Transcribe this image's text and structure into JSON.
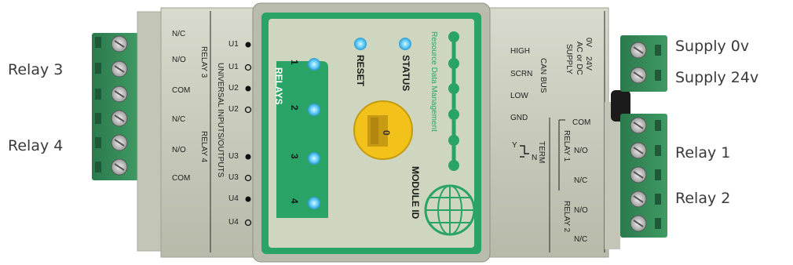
{
  "callouts": {
    "relay3": "Relay 3",
    "relay4": "Relay 4",
    "supply0": "Supply 0v",
    "supply24": "Supply 24v",
    "relay1": "Relay 1",
    "relay2": "Relay 2"
  },
  "left_panel": {
    "terms": [
      "N/C",
      "N/O",
      "COM",
      "N/C",
      "N/O",
      "COM"
    ],
    "relay3": "RELAY 3",
    "relay4": "RELAY 4",
    "io_title": "UNIVERSAL INPUTS/OUTPUTS",
    "io": [
      "U1",
      "U1",
      "U2",
      "U2",
      "U3",
      "U3",
      "U4",
      "U4"
    ]
  },
  "front": {
    "relays_label": "RELAYS",
    "relay_numbers": [
      "1",
      "2",
      "3",
      "4"
    ],
    "reset": "RESET",
    "status": "STATUS",
    "module_id": "MODULE ID",
    "brand": "Resource Data Management",
    "dial_value": "0"
  },
  "right_panel": {
    "can": [
      "HIGH",
      "SCRN",
      "LOW",
      "GND"
    ],
    "can_bus": "CAN BUS",
    "supply_vals": [
      "0V",
      "24V"
    ],
    "supply_title": "SUPPLY",
    "supply_sub": "AC or DC",
    "term_label": "TERM",
    "term_y": "Y",
    "term_n": "N",
    "relay_terms": [
      "COM",
      "N/O",
      "N/C",
      "N/O",
      "N/C"
    ],
    "relay1": "RELAY 1",
    "relay2": "RELAY 2"
  },
  "colors": {
    "housing": "#c9ccbd",
    "green": "#2f8a5a",
    "bright_green": "#1fb96a",
    "panel": "#d4d8c6",
    "led": "#6fd4ff"
  }
}
